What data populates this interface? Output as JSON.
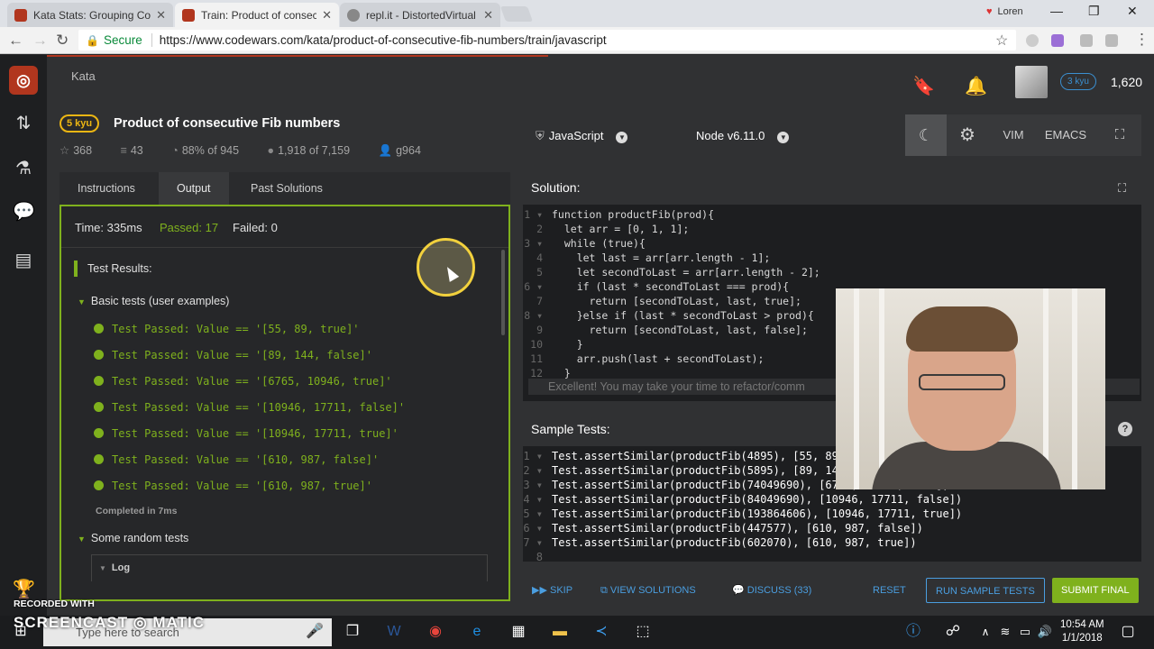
{
  "browser": {
    "tabs": [
      {
        "title": "Kata Stats: Grouping Co"
      },
      {
        "title": "Train: Product of consec"
      },
      {
        "title": "repl.it - DistortedVirtual"
      }
    ],
    "user": "Loren",
    "secure_label": "Secure",
    "url": "https://www.codewars.com/kata/product-of-consecutive-fib-numbers/train/javascript"
  },
  "header": {
    "breadcrumb": "Kata",
    "rank_badge": "3 kyu",
    "honor": "1,620"
  },
  "kata": {
    "rank": "5 kyu",
    "title": "Product of consecutive Fib numbers",
    "stars": "368",
    "collections": "43",
    "satisfaction": "88% of 945",
    "completed": "1,918 of 7,159",
    "author": "g964"
  },
  "tabs": {
    "instructions": "Instructions",
    "output": "Output",
    "past_solutions": "Past Solutions"
  },
  "output": {
    "time": "Time: 335ms",
    "passed": "Passed: 17",
    "failed": "Failed: 0",
    "results_label": "Test Results:",
    "group1": "Basic tests (user examples)",
    "tests": [
      "Test Passed: Value == '[55, 89, true]'",
      "Test Passed: Value == '[89, 144, false]'",
      "Test Passed: Value == '[6765, 10946, true]'",
      "Test Passed: Value == '[10946, 17711, false]'",
      "Test Passed: Value == '[10946, 17711, true]'",
      "Test Passed: Value == '[610, 987, false]'",
      "Test Passed: Value == '[610, 987, true]'"
    ],
    "completed": "Completed in 7ms",
    "group2": "Some random tests",
    "log": "Log"
  },
  "editor": {
    "language": "JavaScript",
    "runtime": "Node v6.11.0",
    "vim": "VIM",
    "emacs": "EMACS",
    "solution_label": "Solution:",
    "excellent": "Excellent! You may take your time to refactor/comm",
    "sample_label": "Sample Tests:",
    "code_lines": [
      "function productFib(prod){",
      "  let arr = [0, 1, 1];",
      "  while (true){",
      "    let last = arr[arr.length - 1];",
      "    let secondToLast = arr[arr.length - 2];",
      "    if (last * secondToLast === prod){",
      "      return [secondToLast, last, true];",
      "    }else if (last * secondToLast > prod){",
      "      return [secondToLast, last, false];",
      "    }",
      "    arr.push(last + secondToLast);",
      "  }"
    ],
    "sample_lines": [
      "Test.assertSimilar(productFib(4895), [55, 89, true])",
      "Test.assertSimilar(productFib(5895), [89, 144, false])",
      "Test.assertSimilar(productFib(74049690), [6765, 10946, true])",
      "Test.assertSimilar(productFib(84049690), [10946, 17711, false])",
      "Test.assertSimilar(productFib(193864606), [10946, 17711, true])",
      "Test.assertSimilar(productFib(447577), [610, 987, false])",
      "Test.assertSimilar(productFib(602070), [610, 987, true])",
      ""
    ]
  },
  "actions": {
    "skip": "SKIP",
    "view_solutions": "VIEW SOLUTIONS",
    "discuss": "DISCUSS (33)",
    "reset": "RESET",
    "run_sample": "RUN SAMPLE TESTS",
    "submit": "SUBMIT FINAL"
  },
  "taskbar": {
    "search_placeholder": "Type here to search",
    "time": "10:54 AM",
    "date": "1/1/2018"
  },
  "watermark": {
    "line1": "RECORDED WITH",
    "line2": "SCREENCAST",
    "line3": "MATIC"
  }
}
